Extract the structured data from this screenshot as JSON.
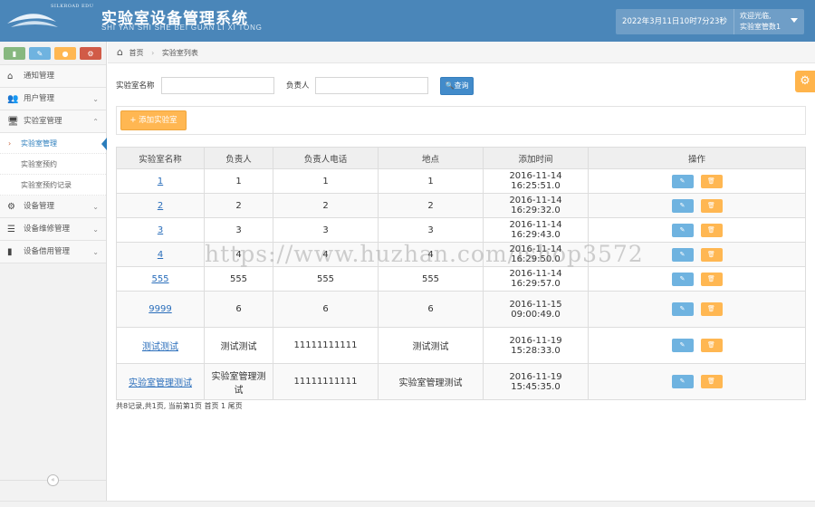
{
  "header": {
    "logo_text": "SILKROAD EDU",
    "title": "实验室设备管理系统",
    "subtitle": "SHI YAN SHI SHE BEI GUAN LI XI TONG",
    "datetime": "2022年3月11日10时7分23秒",
    "welcome": "欢迎光临,",
    "username": "实验室管数1"
  },
  "sidebar": {
    "items": [
      {
        "label": "通知管理",
        "icon": "home-icon"
      },
      {
        "label": "用户管理",
        "icon": "users-icon"
      },
      {
        "label": "实验室管理",
        "icon": "desktop-icon"
      },
      {
        "label": "设备管理",
        "icon": "cogs-icon"
      },
      {
        "label": "设备维修管理",
        "icon": "list-icon"
      },
      {
        "label": "设备借用管理",
        "icon": "bookmark-icon"
      }
    ],
    "sub_items": [
      "实验室管理",
      "实验室预约",
      "实验室预约记录"
    ]
  },
  "breadcrumb": {
    "home": "首页",
    "current": "实验室列表"
  },
  "search": {
    "name_label": "实验室名称",
    "name_value": "",
    "owner_label": "负责人",
    "owner_value": "",
    "query_button": "查询"
  },
  "add_button": "添加实验室",
  "table": {
    "headers": [
      "实验室名称",
      "负责人",
      "负责人电话",
      "地点",
      "添加时间",
      "操作"
    ],
    "rows": [
      {
        "name": "1",
        "owner": "1",
        "phone": "1",
        "location": "1",
        "time": "2016-11-14 16:25:51.0"
      },
      {
        "name": "2",
        "owner": "2",
        "phone": "2",
        "location": "2",
        "time": "2016-11-14 16:29:32.0"
      },
      {
        "name": "3",
        "owner": "3",
        "phone": "3",
        "location": "3",
        "time": "2016-11-14 16:29:43.0"
      },
      {
        "name": "4",
        "owner": "4",
        "phone": "4",
        "location": "4",
        "time": "2016-11-14 16:29:50.0"
      },
      {
        "name": "555",
        "owner": "555",
        "phone": "555",
        "location": "555",
        "time": "2016-11-14 16:29:57.0"
      },
      {
        "name": "9999",
        "owner": "6",
        "phone": "6",
        "location": "6",
        "time": "2016-11-15 09:00:49.0"
      },
      {
        "name": "测试测试",
        "owner": "测试测试",
        "phone": "11111111111",
        "location": "测试测试",
        "time": "2016-11-19 15:28:33.0"
      },
      {
        "name": "实验室管理测试",
        "owner": "实验室管理测试",
        "phone": "11111111111",
        "location": "实验室管理测试",
        "time": "2016-11-19 15:45:35.0"
      }
    ]
  },
  "pager": "共8记录,共1页, 当前第1页 首页 1 尾页",
  "watermark": "https://www.huzhan.com/ishop3572",
  "colors": {
    "header": "#4a86b9",
    "primary": "#428bca",
    "warning": "#ffb752",
    "info": "#6fb3e0"
  }
}
